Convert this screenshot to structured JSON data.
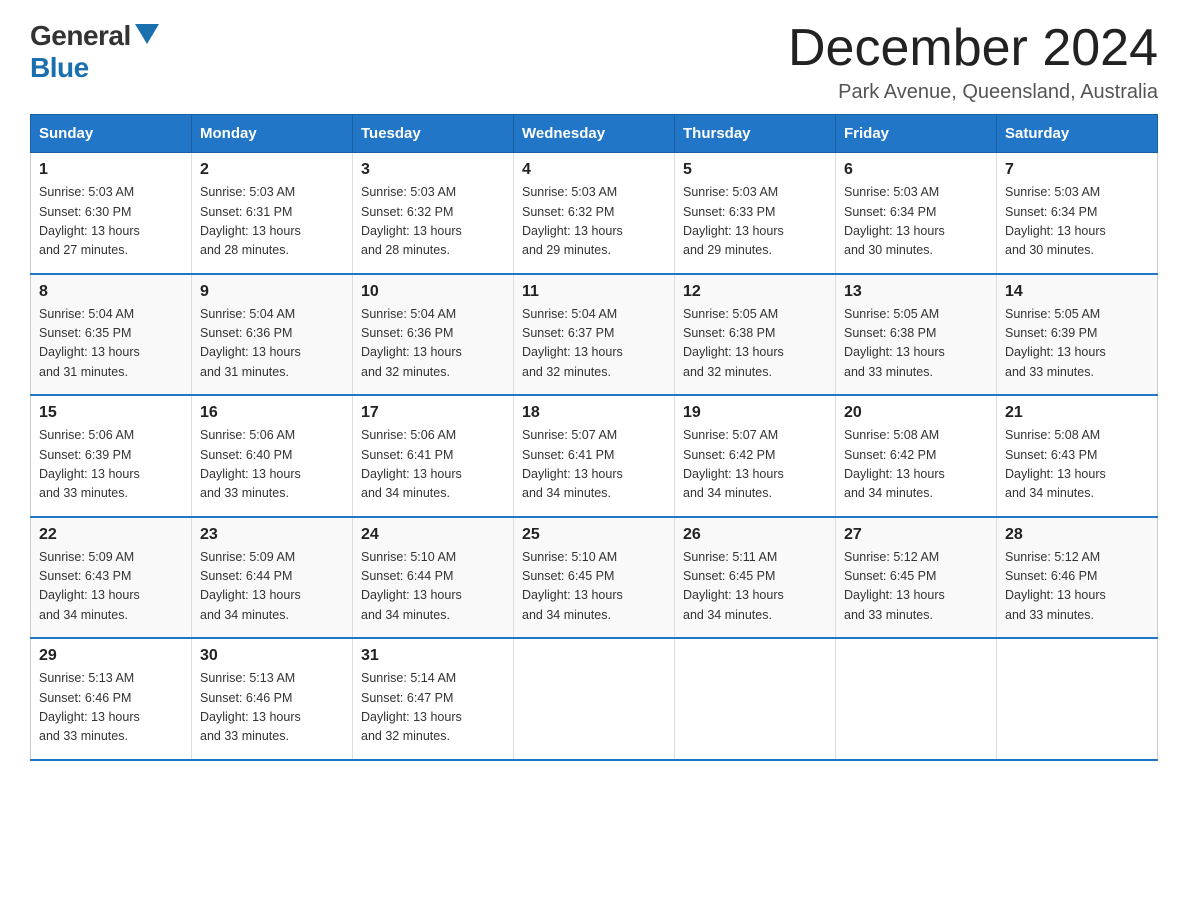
{
  "header": {
    "logo_general": "General",
    "logo_blue": "Blue",
    "month_title": "December 2024",
    "location": "Park Avenue, Queensland, Australia"
  },
  "days_of_week": [
    "Sunday",
    "Monday",
    "Tuesday",
    "Wednesday",
    "Thursday",
    "Friday",
    "Saturday"
  ],
  "weeks": [
    [
      {
        "day": "1",
        "sunrise": "5:03 AM",
        "sunset": "6:30 PM",
        "daylight": "13 hours and 27 minutes."
      },
      {
        "day": "2",
        "sunrise": "5:03 AM",
        "sunset": "6:31 PM",
        "daylight": "13 hours and 28 minutes."
      },
      {
        "day": "3",
        "sunrise": "5:03 AM",
        "sunset": "6:32 PM",
        "daylight": "13 hours and 28 minutes."
      },
      {
        "day": "4",
        "sunrise": "5:03 AM",
        "sunset": "6:32 PM",
        "daylight": "13 hours and 29 minutes."
      },
      {
        "day": "5",
        "sunrise": "5:03 AM",
        "sunset": "6:33 PM",
        "daylight": "13 hours and 29 minutes."
      },
      {
        "day": "6",
        "sunrise": "5:03 AM",
        "sunset": "6:34 PM",
        "daylight": "13 hours and 30 minutes."
      },
      {
        "day": "7",
        "sunrise": "5:03 AM",
        "sunset": "6:34 PM",
        "daylight": "13 hours and 30 minutes."
      }
    ],
    [
      {
        "day": "8",
        "sunrise": "5:04 AM",
        "sunset": "6:35 PM",
        "daylight": "13 hours and 31 minutes."
      },
      {
        "day": "9",
        "sunrise": "5:04 AM",
        "sunset": "6:36 PM",
        "daylight": "13 hours and 31 minutes."
      },
      {
        "day": "10",
        "sunrise": "5:04 AM",
        "sunset": "6:36 PM",
        "daylight": "13 hours and 32 minutes."
      },
      {
        "day": "11",
        "sunrise": "5:04 AM",
        "sunset": "6:37 PM",
        "daylight": "13 hours and 32 minutes."
      },
      {
        "day": "12",
        "sunrise": "5:05 AM",
        "sunset": "6:38 PM",
        "daylight": "13 hours and 32 minutes."
      },
      {
        "day": "13",
        "sunrise": "5:05 AM",
        "sunset": "6:38 PM",
        "daylight": "13 hours and 33 minutes."
      },
      {
        "day": "14",
        "sunrise": "5:05 AM",
        "sunset": "6:39 PM",
        "daylight": "13 hours and 33 minutes."
      }
    ],
    [
      {
        "day": "15",
        "sunrise": "5:06 AM",
        "sunset": "6:39 PM",
        "daylight": "13 hours and 33 minutes."
      },
      {
        "day": "16",
        "sunrise": "5:06 AM",
        "sunset": "6:40 PM",
        "daylight": "13 hours and 33 minutes."
      },
      {
        "day": "17",
        "sunrise": "5:06 AM",
        "sunset": "6:41 PM",
        "daylight": "13 hours and 34 minutes."
      },
      {
        "day": "18",
        "sunrise": "5:07 AM",
        "sunset": "6:41 PM",
        "daylight": "13 hours and 34 minutes."
      },
      {
        "day": "19",
        "sunrise": "5:07 AM",
        "sunset": "6:42 PM",
        "daylight": "13 hours and 34 minutes."
      },
      {
        "day": "20",
        "sunrise": "5:08 AM",
        "sunset": "6:42 PM",
        "daylight": "13 hours and 34 minutes."
      },
      {
        "day": "21",
        "sunrise": "5:08 AM",
        "sunset": "6:43 PM",
        "daylight": "13 hours and 34 minutes."
      }
    ],
    [
      {
        "day": "22",
        "sunrise": "5:09 AM",
        "sunset": "6:43 PM",
        "daylight": "13 hours and 34 minutes."
      },
      {
        "day": "23",
        "sunrise": "5:09 AM",
        "sunset": "6:44 PM",
        "daylight": "13 hours and 34 minutes."
      },
      {
        "day": "24",
        "sunrise": "5:10 AM",
        "sunset": "6:44 PM",
        "daylight": "13 hours and 34 minutes."
      },
      {
        "day": "25",
        "sunrise": "5:10 AM",
        "sunset": "6:45 PM",
        "daylight": "13 hours and 34 minutes."
      },
      {
        "day": "26",
        "sunrise": "5:11 AM",
        "sunset": "6:45 PM",
        "daylight": "13 hours and 34 minutes."
      },
      {
        "day": "27",
        "sunrise": "5:12 AM",
        "sunset": "6:45 PM",
        "daylight": "13 hours and 33 minutes."
      },
      {
        "day": "28",
        "sunrise": "5:12 AM",
        "sunset": "6:46 PM",
        "daylight": "13 hours and 33 minutes."
      }
    ],
    [
      {
        "day": "29",
        "sunrise": "5:13 AM",
        "sunset": "6:46 PM",
        "daylight": "13 hours and 33 minutes."
      },
      {
        "day": "30",
        "sunrise": "5:13 AM",
        "sunset": "6:46 PM",
        "daylight": "13 hours and 33 minutes."
      },
      {
        "day": "31",
        "sunrise": "5:14 AM",
        "sunset": "6:47 PM",
        "daylight": "13 hours and 32 minutes."
      },
      null,
      null,
      null,
      null
    ]
  ],
  "labels": {
    "sunrise": "Sunrise:",
    "sunset": "Sunset:",
    "daylight": "Daylight:"
  }
}
